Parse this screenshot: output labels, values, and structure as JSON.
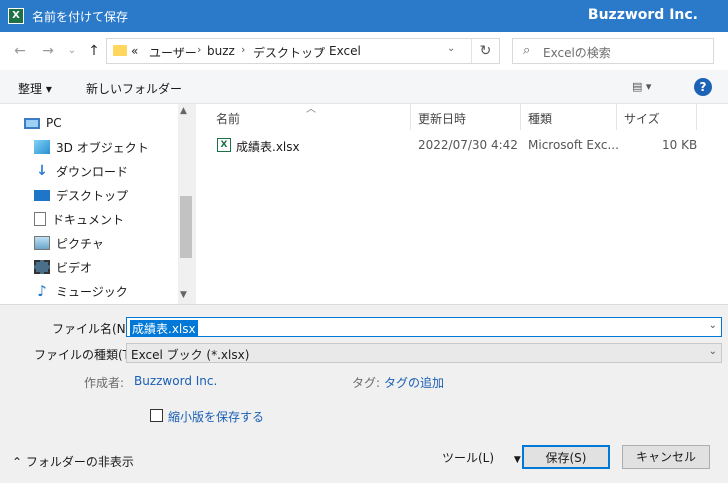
{
  "titlebar": {
    "app_icon": "X",
    "title": "名前を付けて保存",
    "brand": "Buzzword Inc."
  },
  "nav": {
    "back": "←",
    "forward": "→",
    "dropdown": "⌄",
    "up": "↑",
    "breadcrumbs": [
      "«",
      "ユーザー",
      "buzz",
      "デスクトップ",
      "Excel"
    ],
    "refresh": "↻",
    "search_placeholder": "Excelの検索"
  },
  "toolbar": {
    "organize": "整理 ▾",
    "new_folder": "新しいフォルダー",
    "view": "▾",
    "help": "?"
  },
  "sidebar": {
    "items": [
      {
        "label": "PC",
        "icon": "pc-icon"
      },
      {
        "label": "3D オブジェクト",
        "icon": "3d-objects-icon"
      },
      {
        "label": "ダウンロード",
        "icon": "download-icon"
      },
      {
        "label": "デスクトップ",
        "icon": "desktop-icon"
      },
      {
        "label": "ドキュメント",
        "icon": "documents-icon"
      },
      {
        "label": "ピクチャ",
        "icon": "pictures-icon"
      },
      {
        "label": "ビデオ",
        "icon": "videos-icon"
      },
      {
        "label": "ミュージック",
        "icon": "music-icon"
      }
    ]
  },
  "list": {
    "columns": [
      "名前",
      "更新日時",
      "種類",
      "サイズ"
    ],
    "files": [
      {
        "name": "成績表.xlsx",
        "modified": "2022/07/30 4:42",
        "type": "Microsoft Exc...",
        "size": "10 KB"
      }
    ]
  },
  "form": {
    "filename_label": "ファイル名(N):",
    "filename_value": "成績表.xlsx",
    "filetype_label": "ファイルの種類(T):",
    "filetype_value": "Excel ブック (*.xlsx)",
    "author_label": "作成者:",
    "author_value": "Buzzword Inc.",
    "tags_label": "タグ:",
    "tags_value": "タグの追加",
    "thumbnail_label": "縮小版を保存する",
    "hide_folders": "フォルダーの非表示",
    "tools": "ツール(L)",
    "save": "保存(S)",
    "cancel": "キャンセル"
  },
  "colors": {
    "titlebar": "#2b79c9",
    "accent": "#0078d7",
    "link": "#1a5fb4"
  }
}
